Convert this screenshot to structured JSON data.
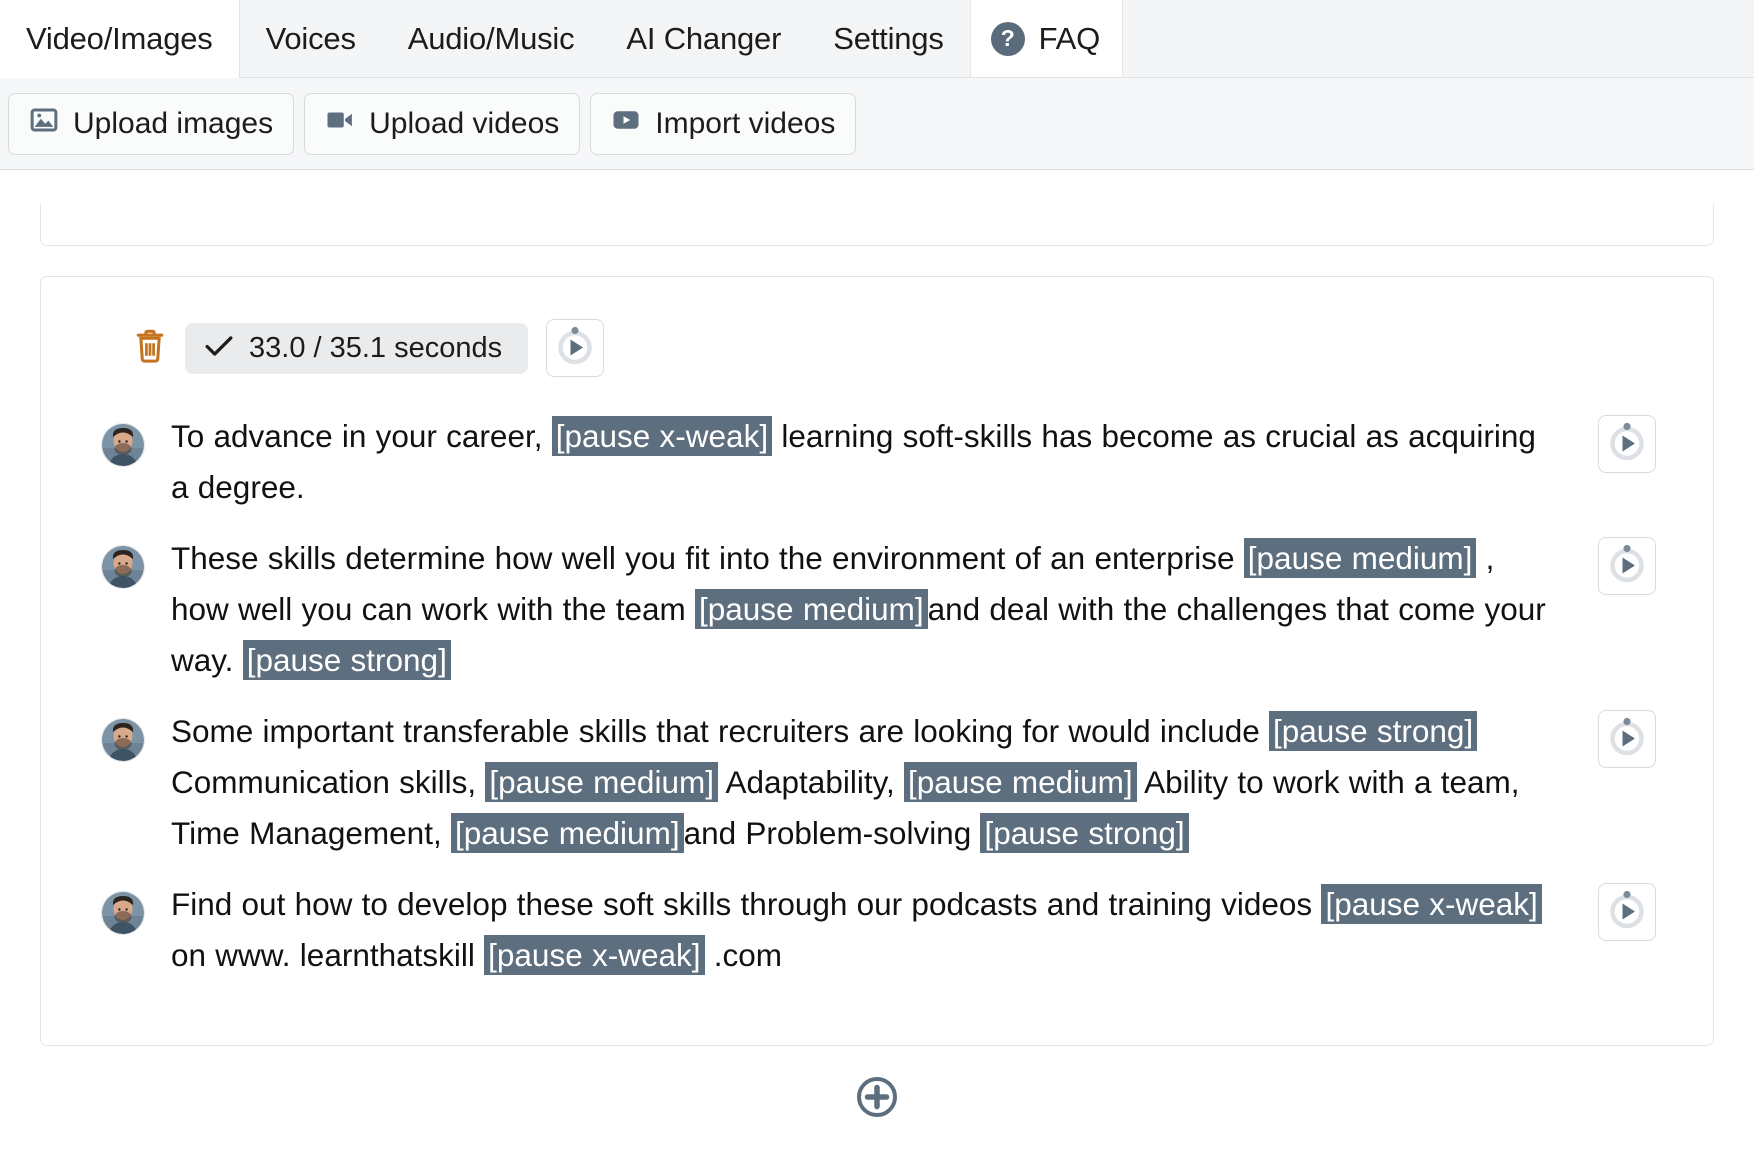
{
  "tabs": [
    {
      "id": "video-images",
      "label": "Video/Images",
      "active": true
    },
    {
      "id": "voices",
      "label": "Voices",
      "active": false
    },
    {
      "id": "audio-music",
      "label": "Audio/Music",
      "active": false
    },
    {
      "id": "ai-changer",
      "label": "AI Changer",
      "active": false
    },
    {
      "id": "settings",
      "label": "Settings",
      "active": false
    }
  ],
  "faq": {
    "label": "FAQ",
    "icon": "question-mark-icon"
  },
  "toolbar": {
    "upload_images_label": "Upload images",
    "upload_videos_label": "Upload videos",
    "import_videos_label": "Import videos",
    "upload_images_icon": "image-icon",
    "upload_videos_icon": "video-camera-icon",
    "import_videos_icon": "play-box-icon"
  },
  "card": {
    "delete_icon": "trash-icon",
    "check_icon": "check-icon",
    "duration_label": "33.0 / 35.1 seconds",
    "duration_used": "33.0",
    "duration_total": "35.1",
    "duration_unit": "seconds",
    "play_icon": "play-icon"
  },
  "colors": {
    "pause_tag_bg": "#5d6e7e",
    "trash": "#c4741f",
    "accent_slate": "#5a6b7b",
    "pill_bg": "#e9ebed",
    "tabstrip_bg": "#f4f5f6"
  },
  "sentences": [
    {
      "id": "sentence-1",
      "avatar": "user-avatar",
      "play_icon": "play-icon",
      "parts": [
        {
          "t": "text",
          "v": "To advance in your career, "
        },
        {
          "t": "tag",
          "v": "[pause x-weak]"
        },
        {
          "t": "text",
          "v": " learning soft-skills has become as crucial as acquiring a degree."
        }
      ]
    },
    {
      "id": "sentence-2",
      "avatar": "user-avatar",
      "play_icon": "play-icon",
      "parts": [
        {
          "t": "text",
          "v": "These skills determine how well you fit into the environment of an enterprise "
        },
        {
          "t": "tag",
          "v": "[pause medium]"
        },
        {
          "t": "text",
          "v": " , how well you can work with the team "
        },
        {
          "t": "tag",
          "v": "[pause medium]"
        },
        {
          "t": "text",
          "v": "and deal with the challenges that come your way.  "
        },
        {
          "t": "tag",
          "v": "[pause strong]"
        }
      ]
    },
    {
      "id": "sentence-3",
      "avatar": "user-avatar",
      "play_icon": "play-icon",
      "parts": [
        {
          "t": "text",
          "v": "Some important transferable skills that recruiters are looking for would include "
        },
        {
          "t": "tag",
          "v": "[pause strong]"
        },
        {
          "t": "text",
          "v": " Communication skills, "
        },
        {
          "t": "tag",
          "v": "[pause medium]"
        },
        {
          "t": "text",
          "v": " Adaptability, "
        },
        {
          "t": "tag",
          "v": "[pause medium]"
        },
        {
          "t": "text",
          "v": " Ability to work with a team, Time Management, "
        },
        {
          "t": "tag",
          "v": "[pause medium]"
        },
        {
          "t": "text",
          "v": "and Problem-solving "
        },
        {
          "t": "tag",
          "v": "[pause strong]"
        }
      ]
    },
    {
      "id": "sentence-4",
      "avatar": "user-avatar",
      "play_icon": "play-icon",
      "parts": [
        {
          "t": "text",
          "v": "Find out how to develop these soft skills through our podcasts and training videos "
        },
        {
          "t": "tag",
          "v": "[pause x-weak]"
        },
        {
          "t": "text",
          "v": " on www. learnthatskill "
        },
        {
          "t": "tag",
          "v": "[pause x-weak]"
        },
        {
          "t": "text",
          "v": " .com"
        }
      ]
    }
  ],
  "add_button": {
    "icon": "plus-circle-icon",
    "label": ""
  }
}
